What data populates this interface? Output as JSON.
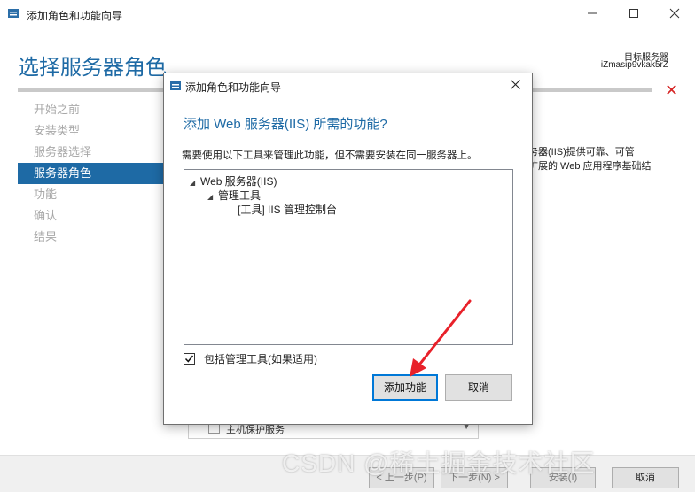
{
  "window": {
    "title": "添加角色和功能向导",
    "page_title": "选择服务器角色",
    "target_label": "目标服务器",
    "target_name": "iZmasip9vkak5rZ"
  },
  "nav": {
    "items": [
      {
        "label": "开始之前",
        "active": false
      },
      {
        "label": "安装类型",
        "active": false
      },
      {
        "label": "服务器选择",
        "active": false
      },
      {
        "label": "服务器角色",
        "active": true
      },
      {
        "label": "功能",
        "active": false
      },
      {
        "label": "确认",
        "active": false
      },
      {
        "label": "结果",
        "active": false
      }
    ]
  },
  "background": {
    "desc_line1": "务器(IIS)提供可靠、可管",
    "desc_line2": "扩展的 Web 应用程序基础结",
    "list_item": "主机保护服务"
  },
  "footer": {
    "prev": "< 上一步(P)",
    "next": "下一步(N) >",
    "install": "安装(I)",
    "cancel": "取消",
    "watermark": "CSDN @稀土掘金技术社区"
  },
  "dialog": {
    "title": "添加角色和功能向导",
    "heading": "添加 Web 服务器(IIS) 所需的功能?",
    "description": "需要使用以下工具来管理此功能，但不需要安装在同一服务器上。",
    "tree": [
      {
        "label": "Web 服务器(IIS)",
        "expanded": true
      },
      {
        "label": "管理工具",
        "expanded": true
      },
      {
        "label": "[工具] IIS 管理控制台"
      }
    ],
    "include_tools_label": "包括管理工具(如果适用)",
    "include_tools_checked": true,
    "add_button": "添加功能",
    "cancel_button": "取消"
  },
  "colors": {
    "accent": "#1e6aa5",
    "arrow": "#e8212a"
  }
}
